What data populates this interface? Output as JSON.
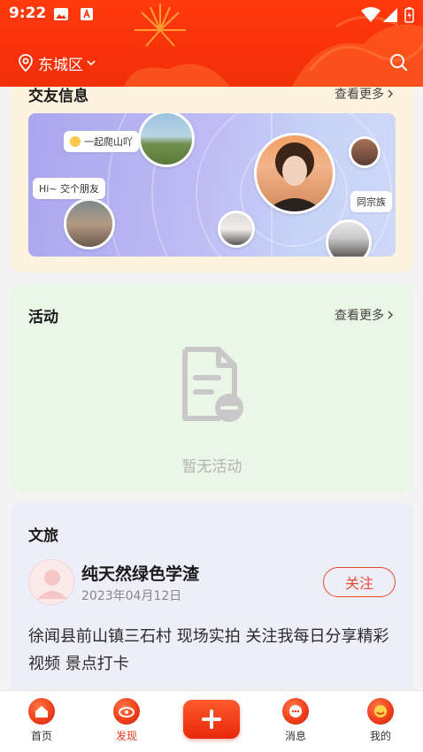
{
  "status_bar": {
    "time": "9:22"
  },
  "header": {
    "location": "东城区"
  },
  "friends": {
    "title": "交友信息",
    "more": "查看更多",
    "bubbles": [
      "一起爬山吖",
      "Hi~ 交个朋友",
      "同宗族"
    ]
  },
  "activity": {
    "title": "活动",
    "more": "查看更多",
    "empty": "暂无活动"
  },
  "travel": {
    "title": "文旅",
    "author": "纯天然绿色学渣",
    "date": "2023年04月12日",
    "follow": "关注",
    "text": "徐闻县前山镇三石村 现场实拍 关注我每日分享精彩视频 景点打卡"
  },
  "nav": {
    "home": "首页",
    "discover": "发现",
    "messages": "消息",
    "mine": "我的"
  },
  "colors": {
    "brand": "#f03109",
    "accent": "#e8361c"
  }
}
